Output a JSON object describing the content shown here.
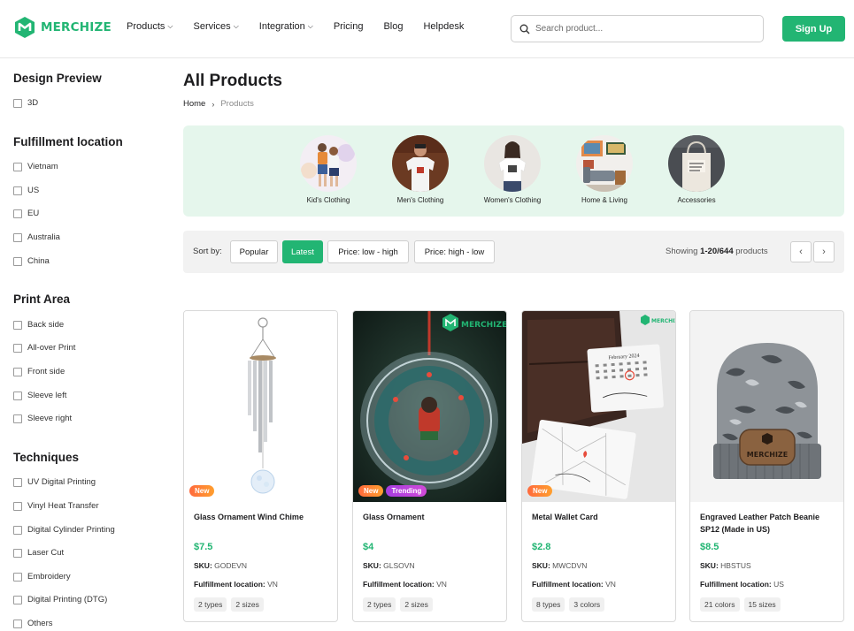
{
  "brand": {
    "name": "MERCHIZE",
    "accent": "#22b573"
  },
  "nav": [
    {
      "label": "Products",
      "has_dropdown": true
    },
    {
      "label": "Services",
      "has_dropdown": true
    },
    {
      "label": "Integration",
      "has_dropdown": true
    },
    {
      "label": "Pricing",
      "has_dropdown": false
    },
    {
      "label": "Blog",
      "has_dropdown": false
    },
    {
      "label": "Helpdesk",
      "has_dropdown": false
    }
  ],
  "search": {
    "placeholder": "Search product...",
    "value": ""
  },
  "signup_label": "Sign Up",
  "filters": [
    {
      "title": "Design Preview",
      "options": [
        "3D"
      ]
    },
    {
      "title": "Fulfillment location",
      "options": [
        "Vietnam",
        "US",
        "EU",
        "Australia",
        "China"
      ]
    },
    {
      "title": "Print Area",
      "options": [
        "Back side",
        "All-over Print",
        "Front side",
        "Sleeve left",
        "Sleeve right"
      ]
    },
    {
      "title": "Techniques",
      "options": [
        "UV Digital Printing",
        "Vinyl Heat Transfer",
        "Digital Cylinder Printing",
        "Laser Cut",
        "Embroidery",
        "Digital Printing (DTG)",
        "Others"
      ]
    }
  ],
  "page_title": "All Products",
  "breadcrumb": {
    "home": "Home",
    "current": "Products"
  },
  "categories": [
    {
      "label": "Kid's Clothing"
    },
    {
      "label": "Men's Clothing"
    },
    {
      "label": "Women's Clothing"
    },
    {
      "label": "Home & Living"
    },
    {
      "label": "Accessories"
    }
  ],
  "sort": {
    "label": "Sort by:",
    "options": [
      "Popular",
      "Latest",
      "Price: low - high",
      "Price: high - low"
    ],
    "active": "Latest"
  },
  "showing": {
    "prefix": "Showing",
    "range": "1-20/644",
    "suffix": "products"
  },
  "products": [
    {
      "name": "Glass Ornament Wind Chime",
      "price": "$7.5",
      "sku_label": "SKU:",
      "sku": "GODEVN",
      "fulfill_label": "Fulfillment location:",
      "fulfill": "VN",
      "chips": [
        "2 types",
        "2 sizes"
      ],
      "badges": [
        "New"
      ]
    },
    {
      "name": "Glass Ornament",
      "price": "$4",
      "sku_label": "SKU:",
      "sku": "GLSOVN",
      "fulfill_label": "Fulfillment location:",
      "fulfill": "VN",
      "chips": [
        "2 types",
        "2 sizes"
      ],
      "badges": [
        "New",
        "Trending"
      ]
    },
    {
      "name": "Metal Wallet Card",
      "price": "$2.8",
      "sku_label": "SKU:",
      "sku": "MWCDVN",
      "fulfill_label": "Fulfillment location:",
      "fulfill": "VN",
      "chips": [
        "8 types",
        "3 colors"
      ],
      "badges": [
        "New"
      ]
    },
    {
      "name": "Engraved Leather Patch Beanie SP12 (Made in US)",
      "price": "$8.5",
      "sku_label": "SKU:",
      "sku": "HBSTUS",
      "fulfill_label": "Fulfillment location:",
      "fulfill": "US",
      "chips": [
        "21 colors",
        "15 sizes"
      ],
      "badges": []
    }
  ],
  "image_text": {
    "watermark": "MERCHIZE",
    "calendar": "February 2024",
    "patch": "MERCHIZE"
  }
}
